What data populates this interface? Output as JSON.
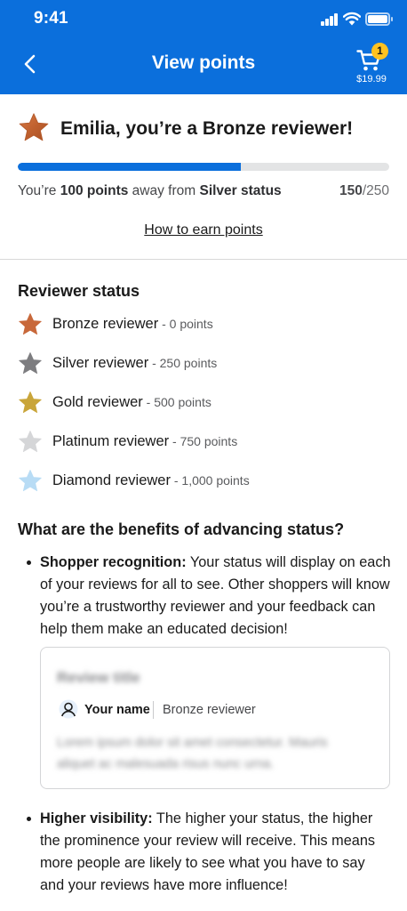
{
  "status_bar": {
    "time": "9:41"
  },
  "header": {
    "title": "View points",
    "back_icon": "chevron-left-icon",
    "cart_icon": "cart-icon",
    "cart_count": "1",
    "cart_total": "$19.99"
  },
  "status_card": {
    "headline": "Emilia, you’re a Bronze reviewer!",
    "badge_icon": "bronze-star-icon",
    "progress_fraction": 0.6,
    "progress_prefix": "You’re ",
    "points_away": "100 points",
    "progress_middle": " away from ",
    "next_status": "Silver status",
    "current_points": "150",
    "total_points": "/250",
    "earn_link": "How to earn points"
  },
  "reviewer_status": {
    "title": "Reviewer status",
    "tiers": [
      {
        "name": "Bronze reviewer",
        "points": " - 0 points",
        "color": "#c8683a",
        "icon": "bronze-star-icon"
      },
      {
        "name": "Silver reviewer",
        "points": " - 250 points",
        "color": "#7d7d80",
        "icon": "silver-star-icon"
      },
      {
        "name": "Gold reviewer",
        "points": " - 500 points",
        "color": "#c9a53a",
        "icon": "gold-star-icon"
      },
      {
        "name": "Platinum reviewer",
        "points": " - 750 points",
        "color": "#d5d6d8",
        "icon": "platinum-star-icon"
      },
      {
        "name": "Diamond reviewer",
        "points": " - 1,000 points",
        "color": "#b8dcf5",
        "icon": "diamond-star-icon"
      }
    ]
  },
  "benefits": {
    "title": "What are the benefits of advancing status?",
    "items": [
      {
        "heading": "Shopper recognition:",
        "text": " Your status will display on each of your reviews for all to see. Other shoppers will know you’re a trustworthy reviewer and your feedback can help them make an educated decision!"
      },
      {
        "heading": "Higher visibility:",
        "text": " The higher your status, the higher the prominence your review will receive. This means more people are likely to see what you have to say and your reviews have more influence!"
      }
    ],
    "sample_review": {
      "title": "Review title",
      "user_name": "Your name",
      "user_status": "Bronze reviewer",
      "body": "Lorem ipsum dolor sit amet consectetur. Mauris aliquet ac malesuada risus nunc urna."
    }
  }
}
